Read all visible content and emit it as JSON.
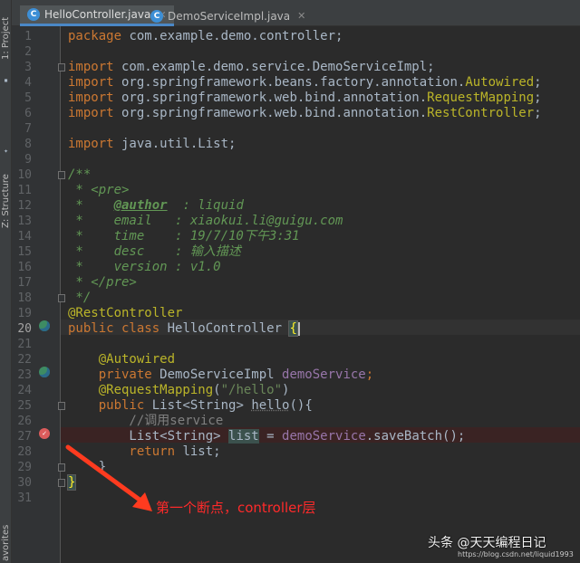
{
  "tool_windows": {
    "project": "1: Project",
    "structure": "Z: Structure",
    "favorites": "avorites"
  },
  "tabs": [
    {
      "label": "HelloController.java",
      "active": true,
      "icon": "java-class-icon"
    },
    {
      "label": "DemoServiceImpl.java",
      "active": false,
      "icon": "java-class-icon"
    }
  ],
  "editor": {
    "line_numbers": [
      "1",
      "2",
      "3",
      "4",
      "5",
      "6",
      "7",
      "8",
      "9",
      "10",
      "11",
      "12",
      "13",
      "14",
      "15",
      "16",
      "17",
      "18",
      "19",
      "20",
      "21",
      "22",
      "23",
      "24",
      "25",
      "26",
      "27",
      "28",
      "29",
      "30",
      "31"
    ],
    "current_line": "20",
    "breakpoint_line": "27",
    "code": {
      "l1_kw": "package",
      "l1_rest": " com.example.demo.controller;",
      "l3_kw": "import",
      "l3_rest": " com.example.demo.service.DemoServiceImpl;",
      "l4_kw": "import",
      "l4_a": " org.springframework.beans.factory.annotation.",
      "l4_b": "Autowired",
      "l4_c": ";",
      "l5_kw": "import",
      "l5_a": " org.springframework.web.bind.annotation.",
      "l5_b": "RequestMapping",
      "l5_c": ";",
      "l6_kw": "import",
      "l6_a": " org.springframework.web.bind.annotation.",
      "l6_b": "RestController",
      "l6_c": ";",
      "l8_kw": "import",
      "l8_rest": " java.util.List;",
      "l10": "/**",
      "l11": " * <pre>",
      "l12_a": " *    ",
      "l12_tag": "@author",
      "l12_b": "  : liquid",
      "l13": " *    email   : xiaokui.li@guigu.com",
      "l14": " *    time    : 19/7/10下午3:31",
      "l15": " *    desc    : 输入描述",
      "l16": " *    version : v1.0",
      "l17": " * </pre>",
      "l18": " */",
      "l19": "@RestController",
      "l20_kw": "public class",
      "l20_name": " HelloController ",
      "l20_brace": "{",
      "l22": "    @Autowired",
      "l23_kw": "    private",
      "l23_type": " DemoServiceImpl ",
      "l23_field": "demoService",
      "l23_end": ";",
      "l24_ann": "    @RequestMapping",
      "l24_a": "(",
      "l24_str": "\"/hello\"",
      "l24_b": ")",
      "l25_kw": "    public",
      "l25_type": " List<String> ",
      "l25_fn": "hello",
      "l25_end": "(){",
      "l26": "        //调用service",
      "l27_a": "        List<String> ",
      "l27_var": "list",
      "l27_b": " = ",
      "l27_field": "demoService",
      "l27_c": ".saveBatch();",
      "l28_kw": "        return",
      "l28_rest": " list;",
      "l29": "    }",
      "l30": "}"
    }
  },
  "annotation": {
    "text": "第一个断点，controller层",
    "color": "#ff2a2a"
  },
  "watermark": {
    "text": "头条 @天天编程日记",
    "url": "https://blog.csdn.net/liquid1993"
  },
  "colors": {
    "background": "#2b2b2b",
    "keyword": "#cc7832",
    "annotation": "#bbb529",
    "doc_comment": "#629755",
    "field": "#9876aa",
    "breakpoint": "#db5c5c",
    "active_tab_underline": "#4a88c7"
  }
}
